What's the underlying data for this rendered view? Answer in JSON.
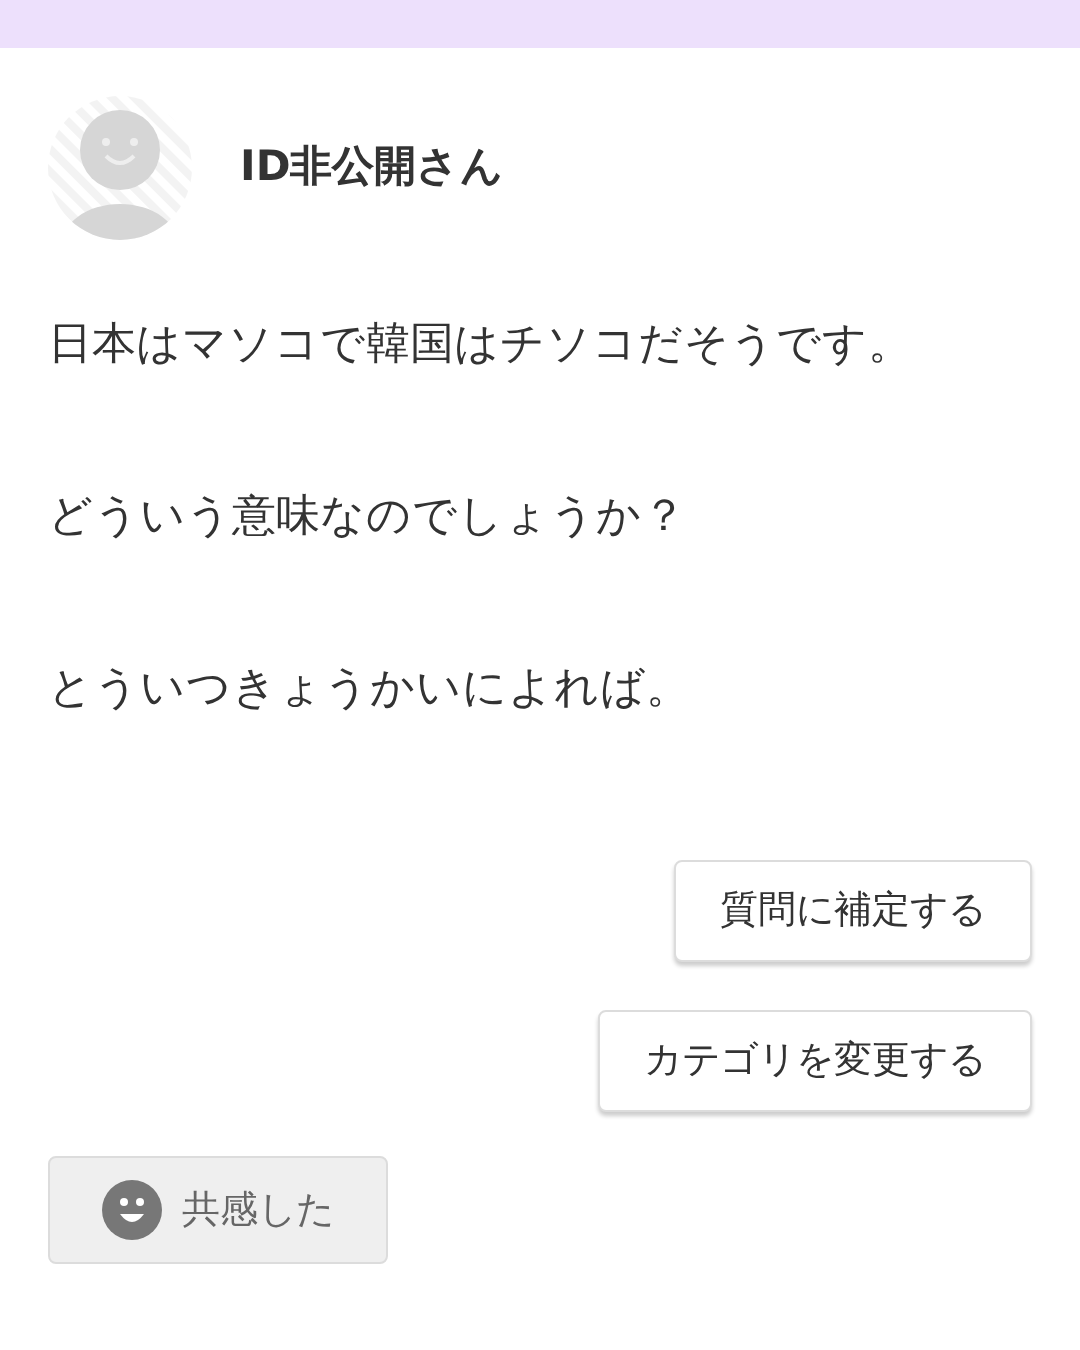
{
  "user": {
    "name": "ID非公開さん"
  },
  "question": {
    "paragraphs": [
      "日本はマソコで韓国はチソコだそうです。",
      "どういう意味なのでしょうか？",
      "とういつきょうかいによれば。"
    ]
  },
  "actions": [
    {
      "label": "質問に補定する"
    },
    {
      "label": "カテゴリを変更する"
    }
  ],
  "empathy": {
    "label": "共感した",
    "selected": true
  }
}
